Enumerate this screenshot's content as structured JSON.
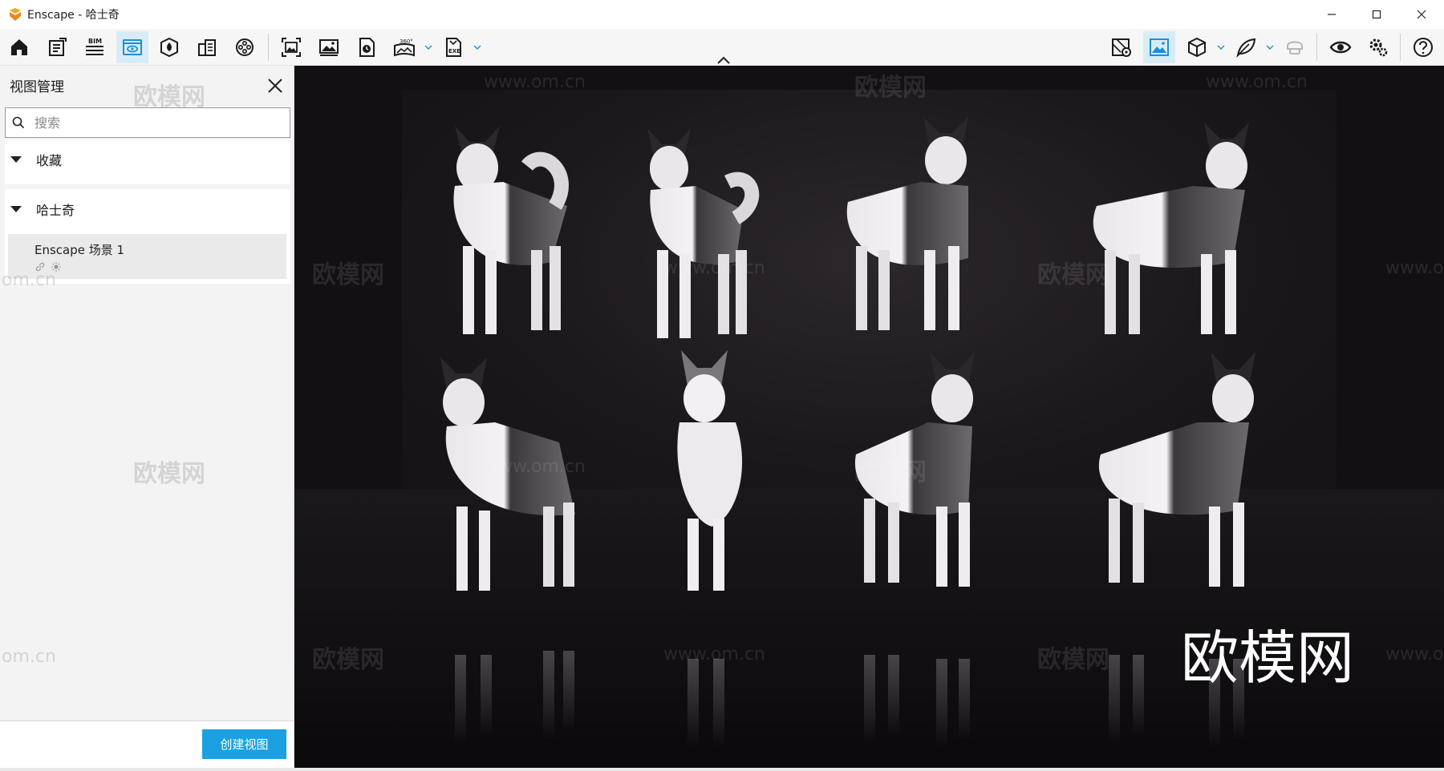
{
  "window": {
    "app_name": "Enscape",
    "title": "Enscape - 哈士奇",
    "controls": [
      "minimize-icon",
      "maximize-icon",
      "close-icon"
    ]
  },
  "toolbar": {
    "left_icons": [
      "home-icon",
      "notes-icon",
      "bim-icon",
      "view-management-icon",
      "asset-library-icon",
      "buildings-icon",
      "video-reel-icon",
      "screenshot-icon",
      "image-icon",
      "panorama-file-icon",
      "panorama-360-icon",
      "exe-export-icon"
    ],
    "bim_label": "BIM",
    "pano_label": "360°",
    "exe_label": "EXE",
    "active": "view-management-icon",
    "right_icons": [
      "map-marker-icon",
      "image-panel-icon",
      "cube-icon",
      "leaf-icon",
      "vr-headset-icon",
      "eye-icon",
      "settings-icon",
      "help-icon"
    ]
  },
  "sidebar": {
    "title": "视图管理",
    "search": {
      "placeholder": "搜索",
      "value": ""
    },
    "groups": [
      {
        "label": "收藏",
        "items": []
      },
      {
        "label": "哈士奇",
        "items": [
          {
            "label": "Enscape 场景 1",
            "icons": [
              "link-icon",
              "sun-icon"
            ]
          }
        ]
      }
    ],
    "create_button": "创建视图"
  },
  "viewport": {
    "subject": "8 husky dog models",
    "watermark_brand": "欧模网",
    "watermark_url": "www.om.cn",
    "watermark_url_partial": "om.cn",
    "watermark_url_cut": "www.o",
    "watermark_big": "欧模网"
  },
  "colors": {
    "accent": "#1ba1e2",
    "active_tool_bg": "#d8ecf7",
    "viewport_bg": "#121012"
  }
}
